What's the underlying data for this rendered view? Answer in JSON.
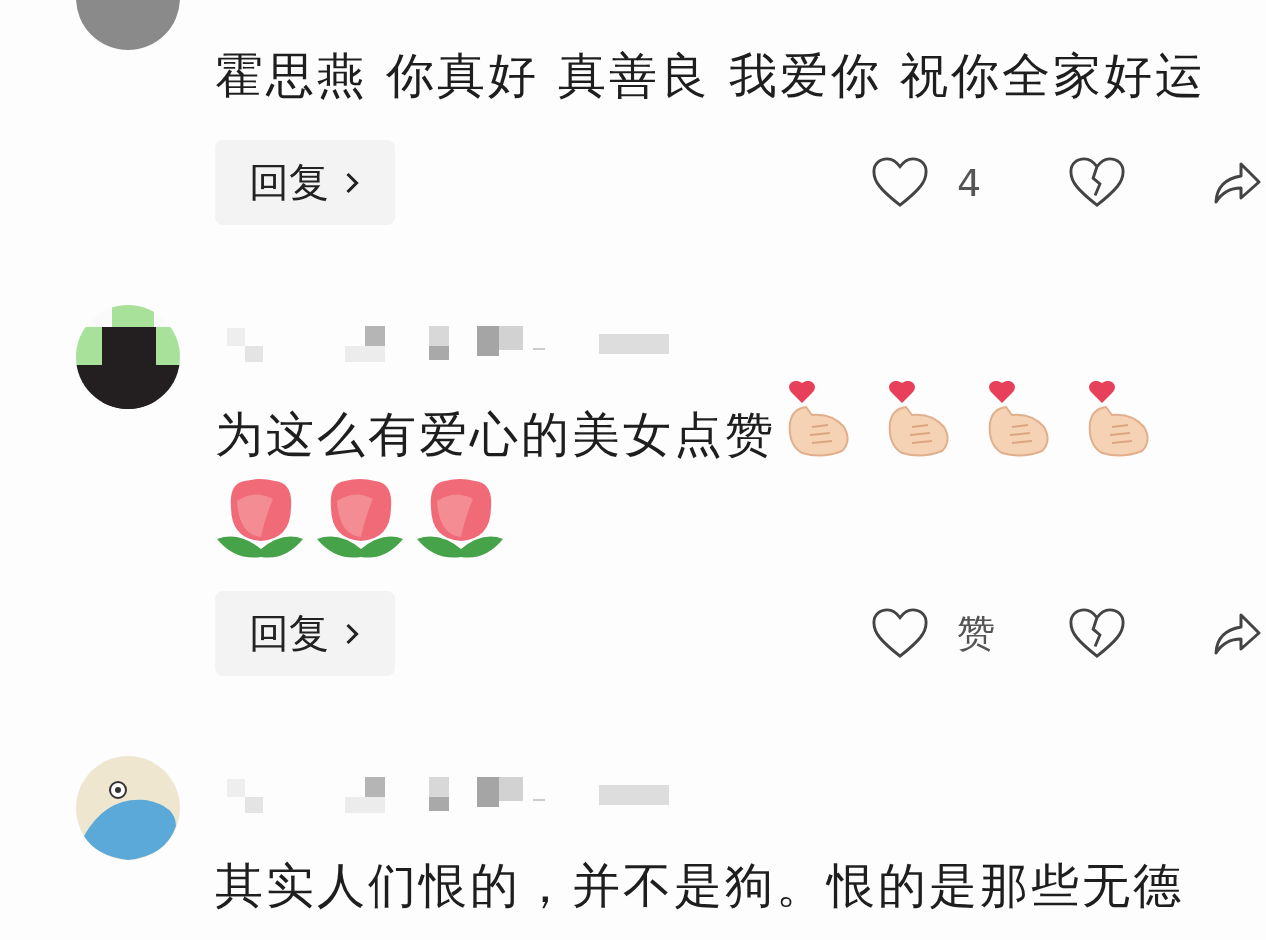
{
  "comments": [
    {
      "avatar": {
        "kind": "photo"
      },
      "username_blurred": false,
      "content": [
        {
          "kind": "text",
          "text": "霍思燕 你真好 真善良 我爱你 祝你全家好运"
        }
      ],
      "actions": {
        "reply": "回复",
        "likes": "4"
      }
    },
    {
      "avatar": {
        "kind": "pixel"
      },
      "username_blurred": true,
      "content": [
        {
          "kind": "text",
          "text": "为这么有爱心的美女点赞"
        },
        {
          "kind": "finger-heart"
        },
        {
          "kind": "finger-heart"
        },
        {
          "kind": "finger-heart"
        },
        {
          "kind": "finger-heart"
        },
        {
          "kind": "break"
        },
        {
          "kind": "rose"
        },
        {
          "kind": "rose"
        },
        {
          "kind": "rose"
        }
      ],
      "actions": {
        "reply": "回复",
        "likes": "赞"
      }
    },
    {
      "avatar": {
        "kind": "cartoon"
      },
      "username_blurred": true,
      "content": [
        {
          "kind": "text",
          "text": "其实人们恨的，并不是狗。恨的是那些无德"
        }
      ]
    }
  ]
}
